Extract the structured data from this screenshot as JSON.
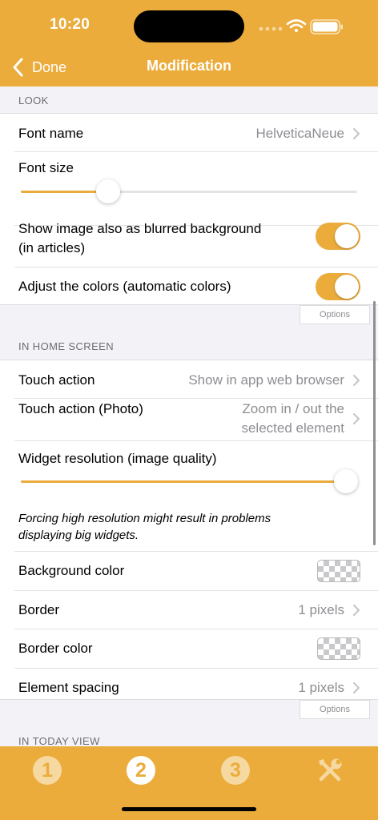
{
  "status_bar": {
    "time": "10:20"
  },
  "nav": {
    "back_label": "Done",
    "title": "Modification"
  },
  "sections": {
    "look": {
      "header": "LOOK",
      "font_name": {
        "label": "Font name",
        "value": "HelveticaNeue"
      },
      "font_size": {
        "label": "Font size",
        "slider_level": 0.26
      },
      "blurred_background": {
        "label_line1": "Show image also as blurred background",
        "label_line2": "(in articles)",
        "on": true
      },
      "adjust_colors": {
        "label": "Adjust the colors (automatic colors)",
        "on": true
      },
      "options_label": "Options"
    },
    "home_screen": {
      "header": "IN HOME SCREEN",
      "touch_action": {
        "label": "Touch action",
        "value": "Show in app web browser"
      },
      "touch_action_photo": {
        "label": "Touch action (Photo)",
        "value_line1": "Zoom in / out the",
        "value_line2": "selected element"
      },
      "widget_resolution": {
        "label": "Widget resolution (image quality)",
        "slider_level": 1.0
      },
      "note_line1": "Forcing high resolution might result in problems",
      "note_line2": "displaying big widgets.",
      "background_color": {
        "label": "Background color"
      },
      "border": {
        "label": "Border",
        "value": "1 pixels"
      },
      "border_color": {
        "label": "Border color"
      },
      "element_spacing": {
        "label": "Element spacing",
        "value": "1 pixels"
      },
      "options_label": "Options"
    },
    "today_view": {
      "header": "IN TODAY VIEW"
    }
  },
  "tabbar": {
    "tabs": [
      {
        "number": "1",
        "selected": false
      },
      {
        "number": "2",
        "selected": true
      },
      {
        "number": "3",
        "selected": false
      }
    ],
    "tools_icon": "tools-icon"
  },
  "colors": {
    "accent": "#ebac3c",
    "tab_inactive": "#f5d9a1",
    "tab_active": "#ffffff"
  }
}
